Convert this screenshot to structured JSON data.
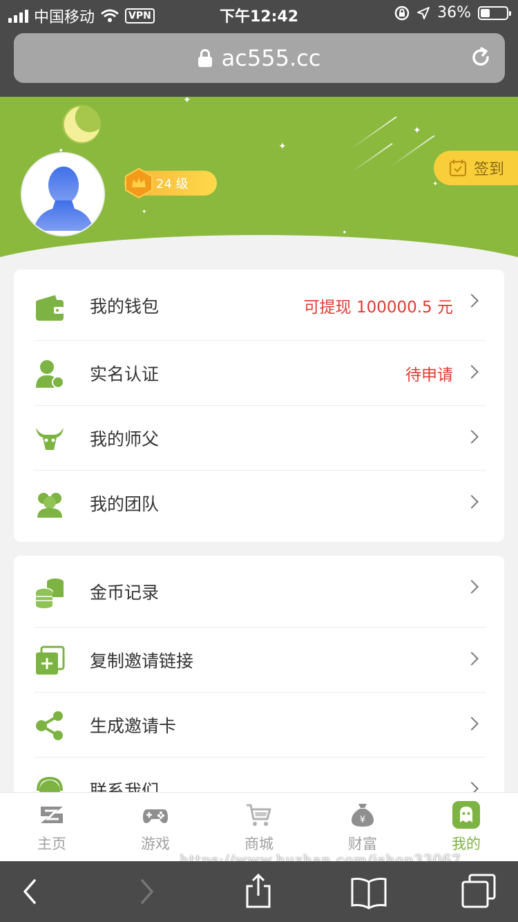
{
  "status_bar": {
    "carrier": "中国移动",
    "vpn": "VPN",
    "time": "下午12:42",
    "battery": "36%",
    "battery_level": 0.36
  },
  "browser": {
    "url": "ac555.cc"
  },
  "profile": {
    "level": "24 级",
    "signin_label": "签到"
  },
  "colors": {
    "brand_green": "#8ab93e",
    "accent_red": "#e03b32",
    "gold": "#f8cf3a"
  },
  "menu1": [
    {
      "label": "我的钱包",
      "extra": "可提现 100000.5 元",
      "icon": "wallet-icon"
    },
    {
      "label": "实名认证",
      "extra": "待申请",
      "icon": "verify-user-icon"
    },
    {
      "label": "我的师父",
      "extra": "",
      "icon": "master-icon"
    },
    {
      "label": "我的团队",
      "extra": "",
      "icon": "team-icon"
    }
  ],
  "menu2": [
    {
      "label": "金币记录",
      "icon": "coins-icon"
    },
    {
      "label": "复制邀请链接",
      "icon": "copy-link-icon"
    },
    {
      "label": "生成邀请卡",
      "icon": "share-icon"
    },
    {
      "label": "联系我们",
      "icon": "contact-icon"
    }
  ],
  "tabs": [
    {
      "label": "主页",
      "icon": "home-z-icon"
    },
    {
      "label": "游戏",
      "icon": "gamepad-icon"
    },
    {
      "label": "商城",
      "icon": "cart-icon"
    },
    {
      "label": "财富",
      "icon": "money-bag-icon"
    },
    {
      "label": "我的",
      "icon": "profile-icon",
      "active": true
    }
  ],
  "watermark": "https://www.huzhan.com/ishop33067"
}
